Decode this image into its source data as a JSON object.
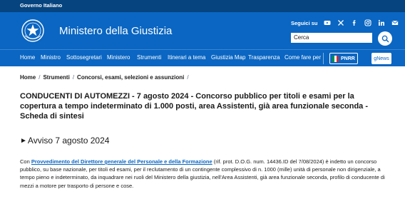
{
  "topbar": {
    "gov_label": "Governo Italiano"
  },
  "header": {
    "site_title": "Ministero della Giustizia"
  },
  "social": {
    "follow_label": "Seguici su",
    "icons": [
      "youtube-icon",
      "x-icon",
      "facebook-icon",
      "instagram-icon",
      "linkedin-icon",
      "email-icon"
    ]
  },
  "search": {
    "value": "Cerca"
  },
  "nav": {
    "items": [
      "Home",
      "Ministro",
      "Sottosegretari",
      "Ministero",
      "Strumenti",
      "Itinerari a tema",
      "Giustizia Map",
      "Trasparenza",
      "Come fare per"
    ],
    "pnrr_label": "PNRR",
    "gnews_label": "gNews"
  },
  "breadcrumb": [
    "Home",
    "Strumenti",
    "Concorsi, esami, selezioni e assunzioni"
  ],
  "article": {
    "title": "CONDUCENTI DI AUTOMEZZI - 7 agosto 2024 - Concorso pubblico per titoli e esami per la copertura a tempo indeterminato di 1.000 posti, area Assistenti, già area funzionale seconda - Scheda di sintesi",
    "notice": "Avviso 7 agosto 2024",
    "para_prefix": "Con ",
    "para_link": "Provvedimento del Direttore generale del Personale e della Formazione",
    "para_rest": " (rif. prot. D.O.G. num. 14436.ID del 7/08/2024) è indetto un concorso pubblico, su base nazionale, per titoli ed esami, per il reclutamento di un contingente complessivo di n. 1000 (mille) unità di personale non dirigenziale, a tempo pieno e indeterminato, da inquadrare nei ruoli del Ministero della giustizia, nell'Area Assistenti, già area funzionale seconda, profilo di conducente di mezzi a motore per trasporto di persone e cose."
  },
  "colors": {
    "topbar": "#06447f",
    "header": "#0a66c2",
    "link": "#0a66c2"
  }
}
